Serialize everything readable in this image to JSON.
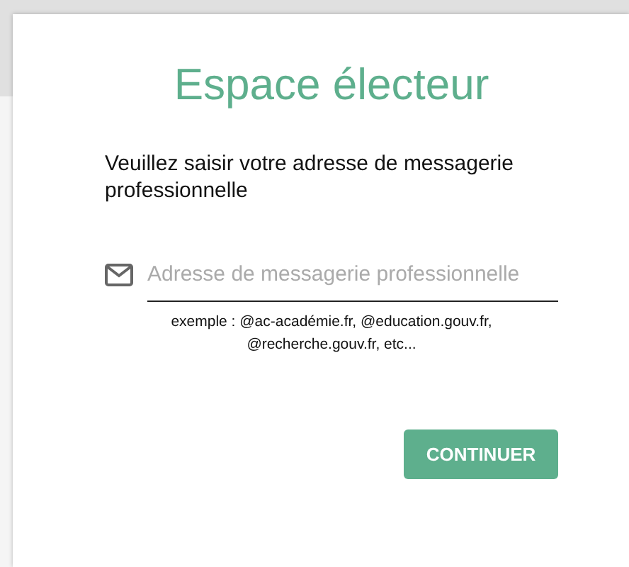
{
  "title": "Espace électeur",
  "instruction": "Veuillez saisir votre adresse de messagerie professionnelle",
  "email_field": {
    "placeholder": "Adresse de messagerie professionnelle"
  },
  "hint": "exemple : @ac-académie.fr, @education.gouv.fr, @recherche.gouv.fr, etc...",
  "continue_button": {
    "label": "CONTINUER"
  }
}
